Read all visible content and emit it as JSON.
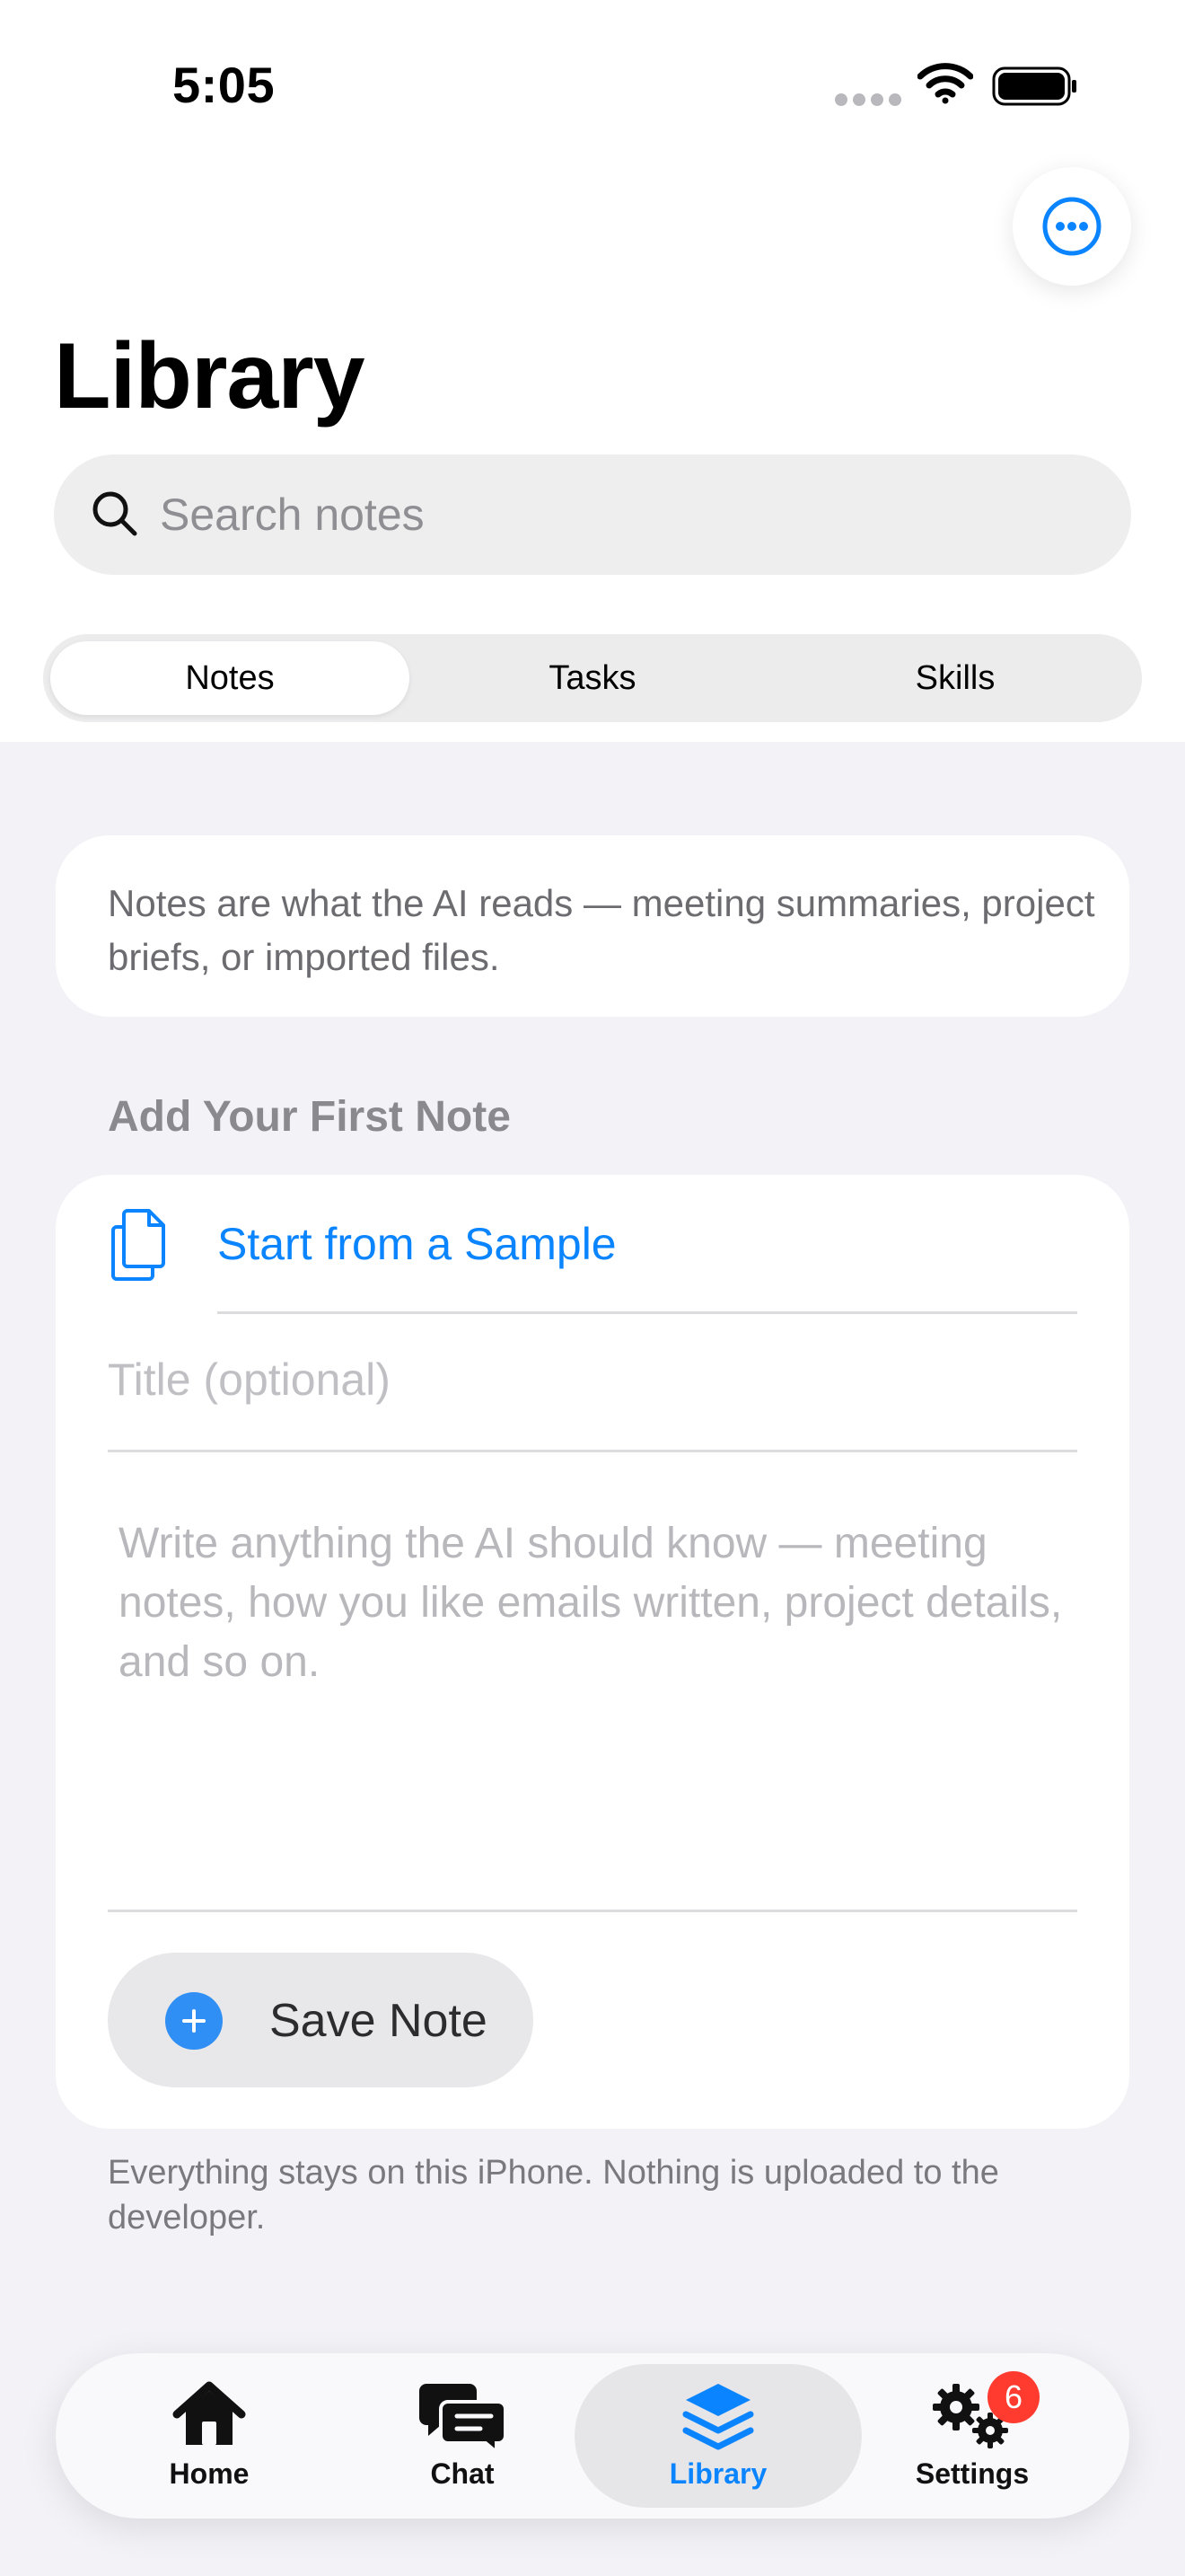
{
  "status_bar": {
    "time": "5:05"
  },
  "header": {
    "title": "Library",
    "more_icon": "ellipsis-circle-icon"
  },
  "search": {
    "placeholder": "Search notes"
  },
  "segments": [
    {
      "label": "Notes",
      "selected": true
    },
    {
      "label": "Tasks",
      "selected": false
    },
    {
      "label": "Skills",
      "selected": false
    }
  ],
  "info": {
    "text": "Notes are what the AI reads — meeting summaries, project briefs, or imported files."
  },
  "add_note": {
    "section_header": "Add Your First Note",
    "sample_label": "Start from a Sample",
    "title_placeholder": "Title (optional)",
    "body_placeholder": "Write anything the AI should know — meeting notes, how you like emails written, project details, and so on.",
    "save_label": "Save Note"
  },
  "footer": {
    "text": "Everything stays on this iPhone. Nothing is uploaded to the developer."
  },
  "tab_bar": {
    "items": [
      {
        "label": "Home",
        "icon": "house-icon"
      },
      {
        "label": "Chat",
        "icon": "chat-bubbles-icon"
      },
      {
        "label": "Library",
        "icon": "stack-icon",
        "selected": true
      },
      {
        "label": "Settings",
        "icon": "gears-icon",
        "badge": "6"
      }
    ]
  },
  "colors": {
    "accent": "#0a84ff",
    "badge": "#ff3b30",
    "background": "#f2f2f7"
  }
}
